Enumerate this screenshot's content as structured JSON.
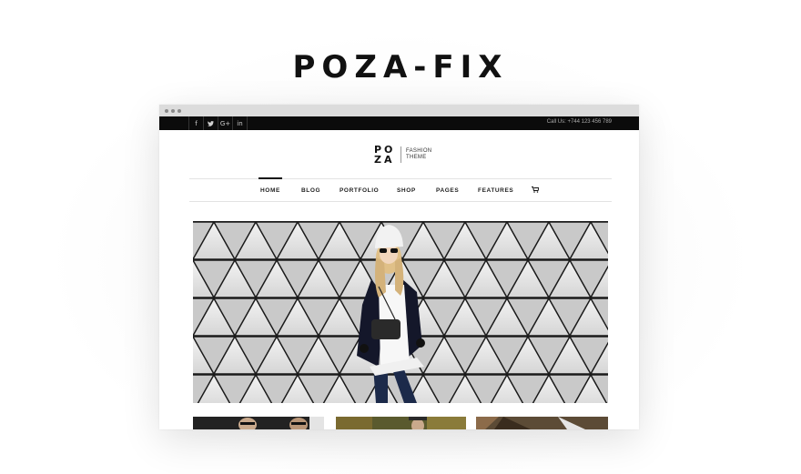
{
  "promo": {
    "title": "POZA-FIX"
  },
  "browser": {
    "chrome_dots": 3
  },
  "topbar": {
    "social_icons": [
      {
        "name": "facebook-icon",
        "glyph": "f"
      },
      {
        "name": "twitter-icon",
        "glyph": "🐦"
      },
      {
        "name": "google-plus-icon",
        "glyph": "G+"
      },
      {
        "name": "linkedin-icon",
        "glyph": "in"
      }
    ],
    "call_text": "Call Us: +744 123 456 789"
  },
  "logo": {
    "line1": "PO",
    "line2": "ZA",
    "tagline1": "FASHION",
    "tagline2": "THEME"
  },
  "nav": {
    "items": [
      "HOME",
      "BLOG",
      "PORTFOLIO",
      "SHOP",
      "PAGES",
      "FEATURES"
    ],
    "active": "HOME",
    "cart_icon": "cart-icon"
  },
  "colors": {
    "topbar": "#0b0b0b",
    "accent": "#111111",
    "coat": "#14172a",
    "wall": "#e6e6e6"
  }
}
